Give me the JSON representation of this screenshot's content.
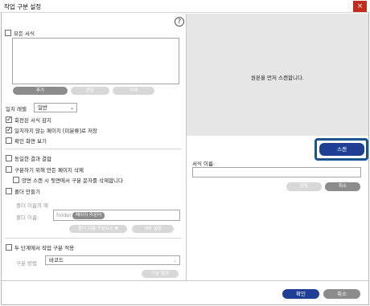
{
  "window": {
    "title": "작업 구분 설정",
    "close": "×"
  },
  "help": "?",
  "all_formats": {
    "label": "모든 서식"
  },
  "buttons": {
    "add": "추가",
    "edit": "편집",
    "delete": "삭제"
  },
  "match_level": {
    "label": "일치 레벨",
    "value": "일반"
  },
  "options": {
    "detect_rotated": "회전된 서식 감지",
    "save_unmatched": "일치하지 않는 페이지 [미분류]로 저장",
    "show_confirm": "확인 화면 보기",
    "merge_same": "동일한 결과 결합",
    "delete_separator": "구분하기 위해 만든 페이지 삭제",
    "delete_back_separator": "양면 스캔 시 뒷면에서 구분 문자를 삭제합니다",
    "make_folder": "폴더 만들기"
  },
  "folder": {
    "example_label": "폴더 이름의 예",
    "name_label": "폴더 이름:",
    "value_text": "folder",
    "tag": "페이지 카운터",
    "compose_button": "폴더 이름 구성요소",
    "compose_arrow": "▼",
    "detail_button": "세부 설정"
  },
  "two_step": {
    "label": "두 단계에서 작업 구분 적용",
    "method_label": "구분 방법",
    "method_value": "바코드",
    "settings_button": "구분 설정"
  },
  "preview": {
    "message": "원본을 먼저 스캔합니다."
  },
  "scan_button": "스캔",
  "format_name": {
    "label": "서식 이름:",
    "value": ""
  },
  "right_buttons": {
    "register": "등록",
    "cancel": "취소"
  },
  "footer": {
    "ok": "확인",
    "cancel": "취소"
  },
  "colors": {
    "accent": "#1e3f93",
    "highlight": "#1a5590",
    "close": "#c42b1c"
  }
}
